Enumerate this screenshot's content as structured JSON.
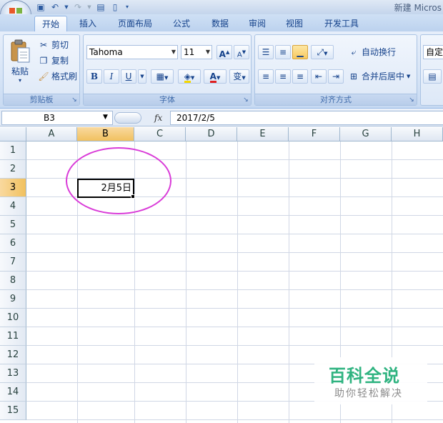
{
  "window": {
    "title": "新建 Micros"
  },
  "tabs": [
    {
      "label": "开始",
      "active": true
    },
    {
      "label": "插入"
    },
    {
      "label": "页面布局"
    },
    {
      "label": "公式"
    },
    {
      "label": "数据"
    },
    {
      "label": "审阅"
    },
    {
      "label": "视图"
    },
    {
      "label": "开发工具"
    }
  ],
  "clipboard": {
    "paste": "粘贴",
    "cut": "剪切",
    "copy": "复制",
    "format_painter": "格式刷",
    "label": "剪贴板"
  },
  "font": {
    "name": "Tahoma",
    "size": "11",
    "label": "字体",
    "bold": "B",
    "italic": "I",
    "underline": "U",
    "grow": "A",
    "shrink": "A",
    "color_glyph": "A",
    "phonetic": "变"
  },
  "alignment": {
    "wrap_text": "自动换行",
    "merge_center": "合并后居中",
    "label": "对齐方式"
  },
  "number": {
    "format": "自定"
  },
  "formula_bar": {
    "name_box": "B3",
    "fx": "fx",
    "value": "2017/2/5"
  },
  "sheet": {
    "columns": [
      "A",
      "B",
      "C",
      "D",
      "E",
      "F",
      "G",
      "H"
    ],
    "rows": [
      "1",
      "2",
      "3",
      "4",
      "5",
      "6",
      "7",
      "8",
      "9",
      "10",
      "11",
      "12",
      "13",
      "14",
      "15"
    ],
    "selected_column": "B",
    "selected_row": "3",
    "cell_b3": "2月5日"
  },
  "watermark": {
    "title": "百科全说",
    "subtitle": "助你轻松解决"
  },
  "colors": {
    "highlight_ellipse": "#d93bd8",
    "fill_yellow": "#f5d800",
    "font_red": "#e02020",
    "watermark_green": "#2fb380"
  }
}
